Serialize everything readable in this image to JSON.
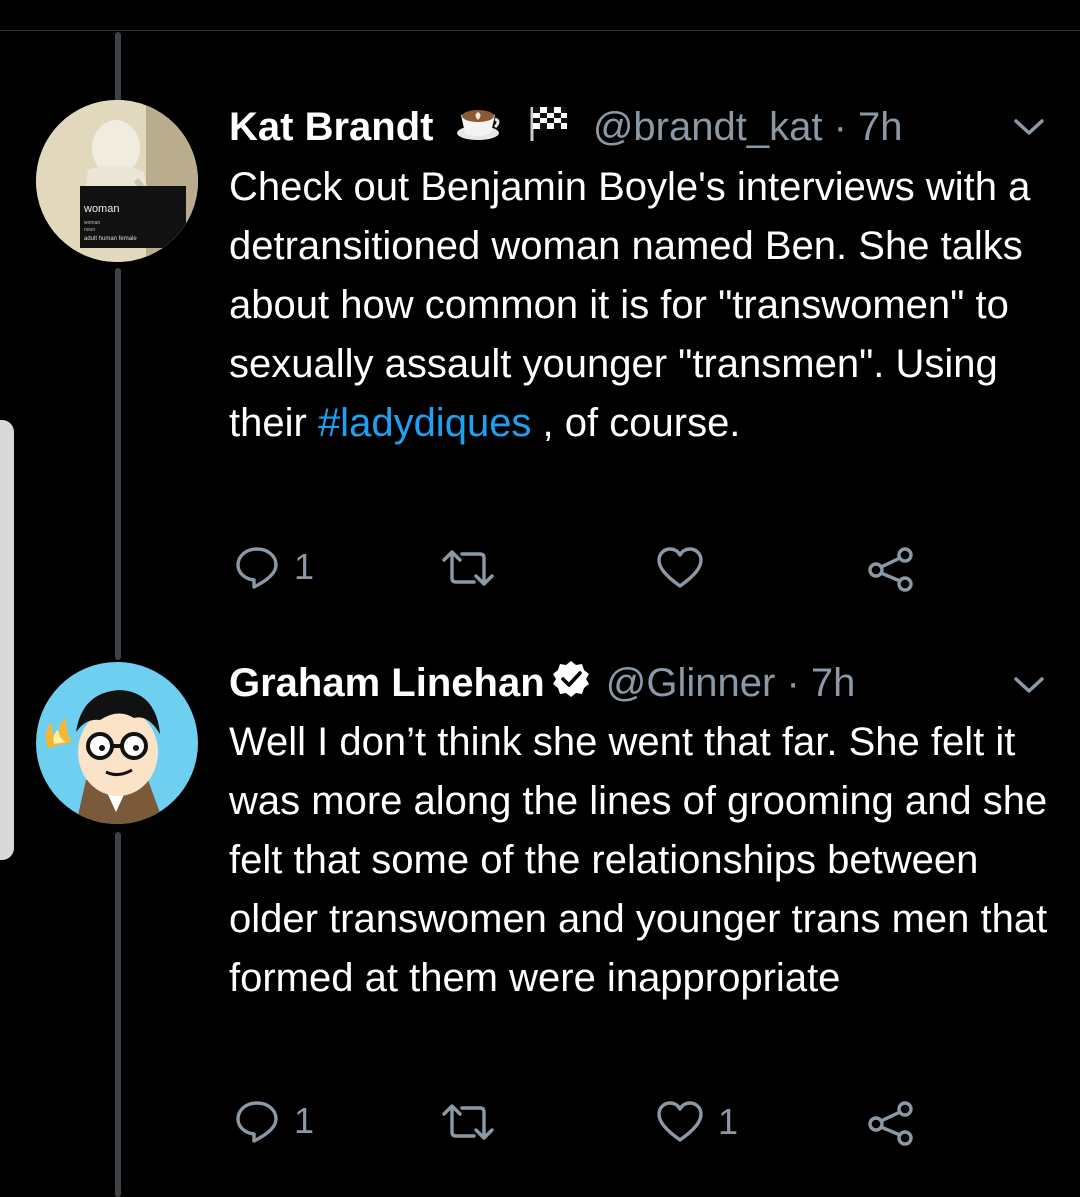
{
  "tweets": [
    {
      "display_name": "Kat Brandt",
      "emoji_badges": [
        "coffee-latte-icon",
        "checkered-flag-icon"
      ],
      "handle": "@brandt_kat",
      "separator": "·",
      "time": "7h",
      "body_before": "Check out Benjamin Boyle's interviews with a detransitioned woman named Ben. She talks about how common it is for \"transwomen\" to sexually assault younger \"transmen\". Using their ",
      "hashtag": "#ladydiques",
      "body_after": " , of course.",
      "avatar_text": [
        "woman",
        "woman",
        "noun",
        "adult human female"
      ],
      "actions": {
        "reply_count": "1",
        "retweet_count": "",
        "like_count": ""
      }
    },
    {
      "display_name": "Graham Linehan",
      "verified": true,
      "handle": "@Glinner",
      "separator": "·",
      "time": "7h",
      "body": "Well I don’t think she went that far. She felt it was more along the lines of grooming and she felt that some of the relationships between older transwomen and younger trans men that formed at them were inappropriate",
      "actions": {
        "reply_count": "1",
        "retweet_count": "",
        "like_count": "1"
      }
    }
  ],
  "colors": {
    "background": "#000000",
    "secondary_text": "#8b98a5",
    "link": "#1da1f2",
    "thread_line": "#3d4247"
  }
}
